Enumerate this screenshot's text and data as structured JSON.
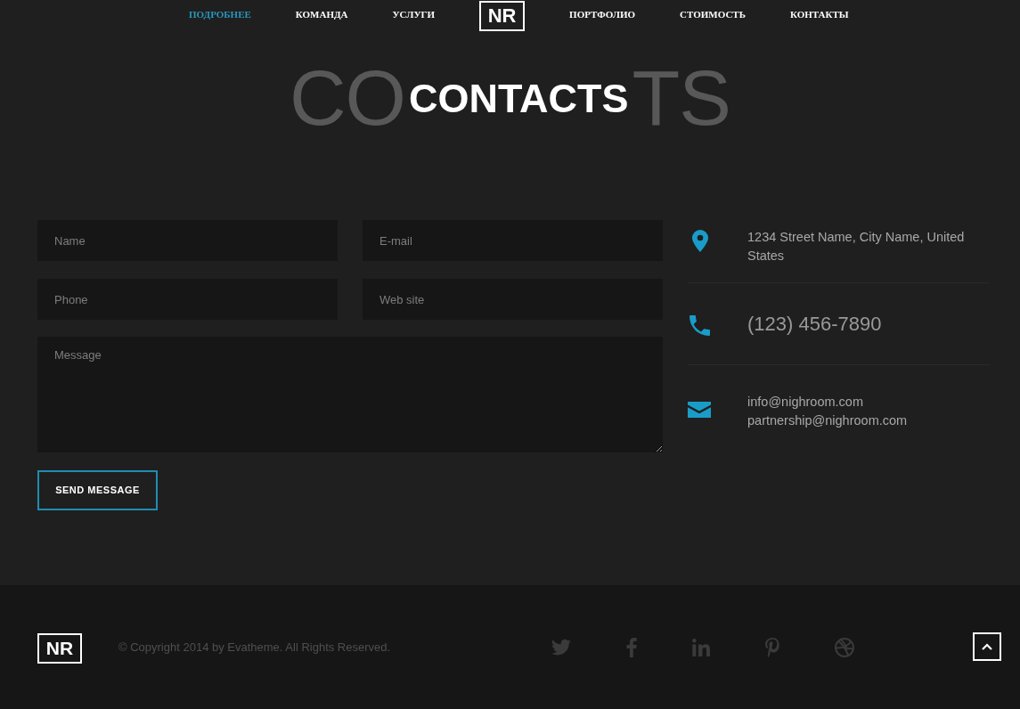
{
  "nav": {
    "left_items": [
      {
        "label": "ПОДРОБНЕЕ",
        "selected": true
      },
      {
        "label": "КОМАНДА",
        "selected": false
      },
      {
        "label": "УСЛУГИ",
        "selected": false
      }
    ],
    "logo": "NR",
    "right_items": [
      {
        "label": "ПОРТФОЛИО",
        "selected": false
      },
      {
        "label": "СТОИМОСТЬ",
        "selected": false
      },
      {
        "label": "КОНТАКТЫ",
        "selected": false
      }
    ]
  },
  "section": {
    "background_title_left": "CO",
    "title": "CONTACTS",
    "background_title_right": "TS"
  },
  "form": {
    "fields": [
      {
        "placeholder": "Name"
      },
      {
        "placeholder": "E-mail"
      },
      {
        "placeholder": "Phone"
      },
      {
        "placeholder": "Web site"
      }
    ],
    "message": {
      "placeholder": "Message"
    },
    "submit_button": "SEND MESSAGE"
  },
  "contact_info": [
    {
      "kind": "address",
      "lines": [
        "1234 Street Name, City Name, United States"
      ]
    },
    {
      "kind": "phone",
      "lines": [
        "(123) 456-7890"
      ]
    },
    {
      "kind": "email",
      "lines": [
        "info@nighroom.com",
        "partnership@nighroom.com"
      ]
    }
  ],
  "footer": {
    "logo": "NR",
    "copyright": "© Copyright 2014 by Evatheme. All Rights Reserved."
  }
}
